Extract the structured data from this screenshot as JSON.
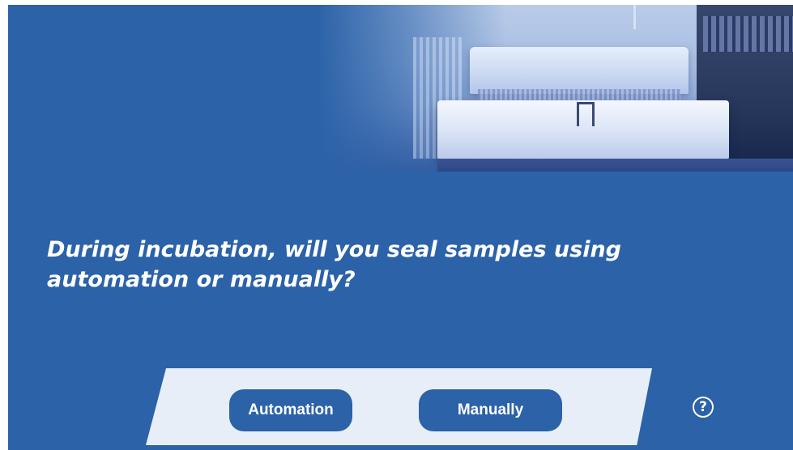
{
  "question": {
    "text": "During incubation, will you seal samples using automation or manually?"
  },
  "options": [
    {
      "label": "Automation"
    },
    {
      "label": "Manually"
    }
  ],
  "help": {
    "icon": "help-icon",
    "glyph": "?"
  },
  "colors": {
    "background": "#2b62a8",
    "panel": "#e8eef8",
    "button": "#2b62a8",
    "text": "#ffffff"
  }
}
